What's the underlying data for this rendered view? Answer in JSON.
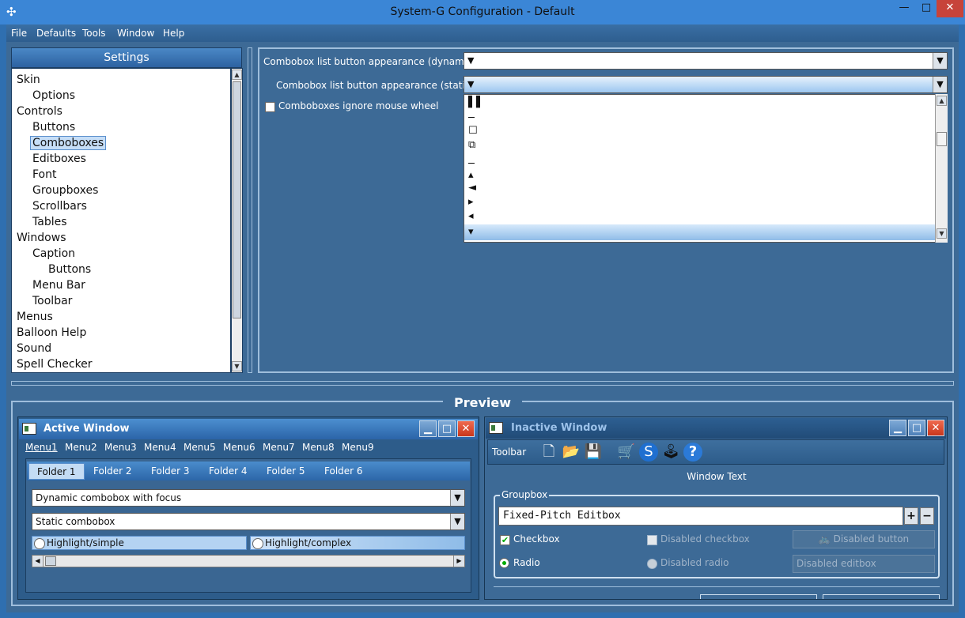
{
  "window": {
    "title": "System-G Configuration - Default",
    "minimize": "—",
    "maximize": "□",
    "close": "✕"
  },
  "menubar": [
    "File",
    "Defaults",
    "Tools",
    "Window",
    "Help"
  ],
  "settings": {
    "header": "Settings",
    "tree": [
      {
        "label": "Skin",
        "level": 0
      },
      {
        "label": "Options",
        "level": 1
      },
      {
        "label": "Controls",
        "level": 0
      },
      {
        "label": "Buttons",
        "level": 1
      },
      {
        "label": "Comboboxes",
        "level": 1,
        "selected": true
      },
      {
        "label": "Editboxes",
        "level": 1
      },
      {
        "label": "Font",
        "level": 1
      },
      {
        "label": "Groupboxes",
        "level": 1
      },
      {
        "label": "Scrollbars",
        "level": 1
      },
      {
        "label": "Tables",
        "level": 1
      },
      {
        "label": "Windows",
        "level": 0
      },
      {
        "label": "Caption",
        "level": 1
      },
      {
        "label": "Buttons",
        "level": 2
      },
      {
        "label": "Menu Bar",
        "level": 1
      },
      {
        "label": "Toolbar",
        "level": 1
      },
      {
        "label": "Menus",
        "level": 0
      },
      {
        "label": "Balloon Help",
        "level": 0
      },
      {
        "label": "Sound",
        "level": 0
      },
      {
        "label": "Spell Checker",
        "level": 0
      }
    ]
  },
  "options": {
    "dynamic_label": "Combobox list button appearance (dynamic):",
    "static_label": "Combobox list button appearance (static):",
    "ignore_wheel_label": "Comboboxes ignore mouse wheel",
    "dropdown_glyphs": [
      "▌▌",
      "─",
      "☐",
      "⧉",
      "─",
      "▴",
      "◄",
      "▸",
      "◂",
      "▾"
    ]
  },
  "preview": {
    "title": "Preview",
    "active": {
      "title": "Active Window",
      "menus": [
        "Menu1",
        "Menu2",
        "Menu3",
        "Menu4",
        "Menu5",
        "Menu6",
        "Menu7",
        "Menu8",
        "Menu9"
      ],
      "tabs": [
        "Folder 1",
        "Folder 2",
        "Folder 3",
        "Folder 4",
        "Folder 5",
        "Folder 6"
      ],
      "dynamic_combo": "Dynamic combobox with focus",
      "static_combo": "Static combobox",
      "radio_simple": "Highlight/simple",
      "radio_complex": "Highlight/complex"
    },
    "inactive": {
      "title": "Inactive Window",
      "toolbar_label": "Toolbar",
      "window_text": "Window Text",
      "groupbox_label": "Groupbox",
      "editbox_value": "Fixed-Pitch Editbox",
      "checkbox": "Checkbox",
      "disabled_checkbox": "Disabled checkbox",
      "disabled_button": "Disabled button",
      "radio": "Radio",
      "disabled_radio": "Disabled radio",
      "disabled_editbox": "Disabled editbox"
    }
  }
}
